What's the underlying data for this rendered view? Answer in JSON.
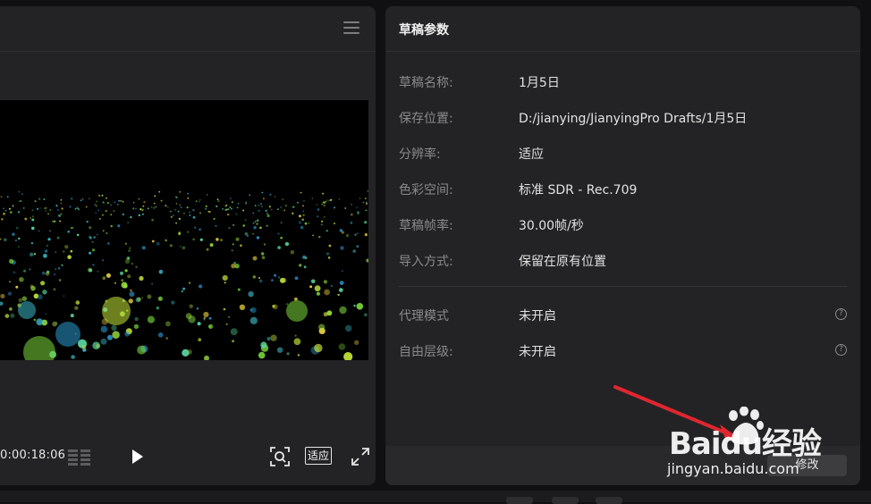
{
  "player": {
    "menu_icon": "menu-icon",
    "timecode": "0:00:18:06",
    "fit_label": "适应",
    "icons": [
      "grid-icon",
      "play-icon",
      "zoom-icon",
      "fullscreen-icon"
    ]
  },
  "params": {
    "title": "草稿参数",
    "rows": [
      {
        "label": "草稿名称:",
        "value": "1月5日"
      },
      {
        "label": "保存位置:",
        "value": "D:/jianying/JianyingPro Drafts/1月5日"
      },
      {
        "label": "分辨率:",
        "value": "适应"
      },
      {
        "label": "色彩空间:",
        "value": "标准 SDR - Rec.709"
      },
      {
        "label": "草稿帧率:",
        "value": "30.00帧/秒"
      },
      {
        "label": "导入方式:",
        "value": "保留在原有位置"
      },
      {
        "label": "代理模式",
        "value": "未开启"
      },
      {
        "label": "自由层级:",
        "value": "未开启"
      }
    ],
    "help_glyph": "?",
    "modify_label": "修改"
  },
  "watermark": {
    "brand": "Baidu经验",
    "site": "jingyan.baidu.com"
  },
  "colors": {
    "panel": "#232325",
    "background": "#101012",
    "arrow": "#e0262f"
  }
}
